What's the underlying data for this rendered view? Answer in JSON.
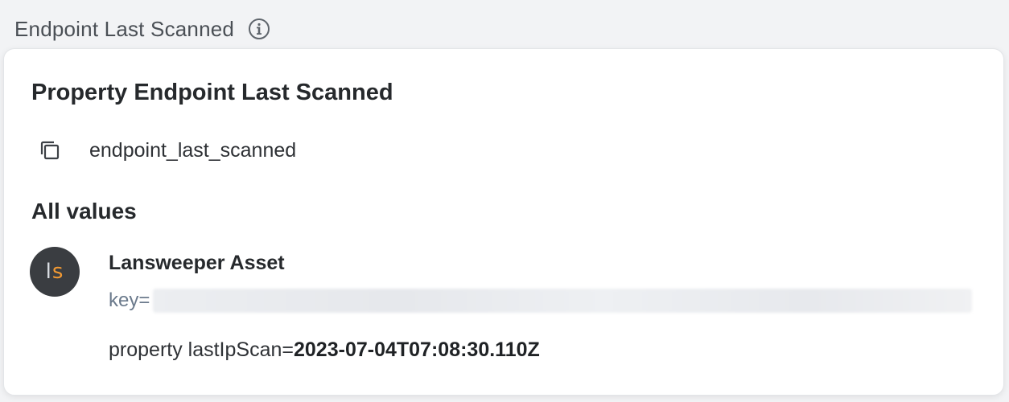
{
  "field": {
    "label": "Endpoint Last Scanned",
    "info_icon": "info-icon"
  },
  "popover": {
    "title": "Property Endpoint Last Scanned",
    "property_key": "endpoint_last_scanned",
    "copy_icon": "copy-icon",
    "section_title": "All values",
    "source": {
      "avatar_letters_l": "l",
      "avatar_letters_s": "s",
      "avatar_bg": "#3a3d41",
      "avatar_accent": "#f29a33",
      "name": "Lansweeper Asset",
      "key_label": "key=",
      "property_label": "property lastIpScan=",
      "property_value": "2023-07-04T07:08:30.110Z"
    }
  }
}
